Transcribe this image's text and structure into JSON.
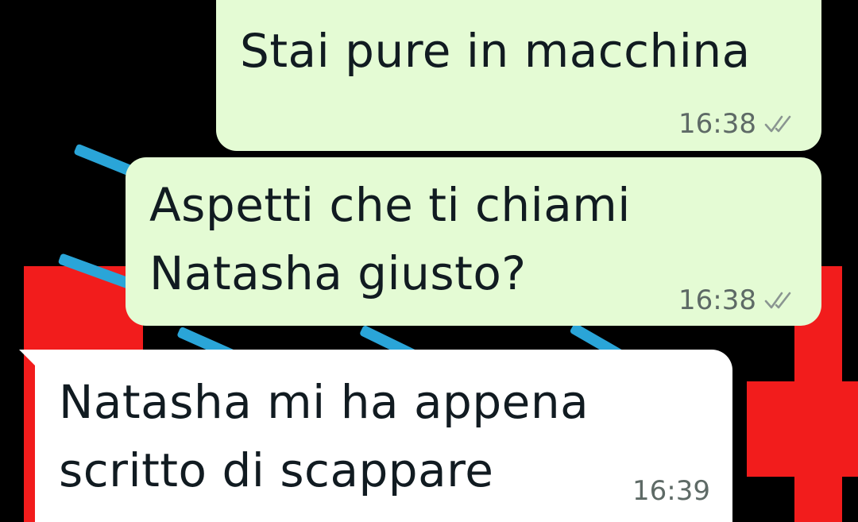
{
  "chat": {
    "messages": [
      {
        "direction": "outgoing",
        "lines": [
          "Stai pure in macchina"
        ],
        "time": "16:38",
        "status_icon": "double-check-icon"
      },
      {
        "direction": "outgoing",
        "lines": [
          "Aspetti che ti chiami",
          "Natasha giusto?"
        ],
        "time": "16:38",
        "status_icon": "double-check-icon"
      },
      {
        "direction": "incoming",
        "lines": [
          "Natasha mi ha appena",
          "scritto di scappare"
        ],
        "time": "16:39"
      }
    ]
  },
  "colors": {
    "outgoing_bubble": "#e4fbd4",
    "incoming_bubble": "#ffffff",
    "wallpaper_background": "#000000",
    "wallpaper_red": "#f21c1c",
    "wallpaper_blue": "#2aa5d8",
    "text": "#111b21",
    "meta": "#5e6a66"
  }
}
